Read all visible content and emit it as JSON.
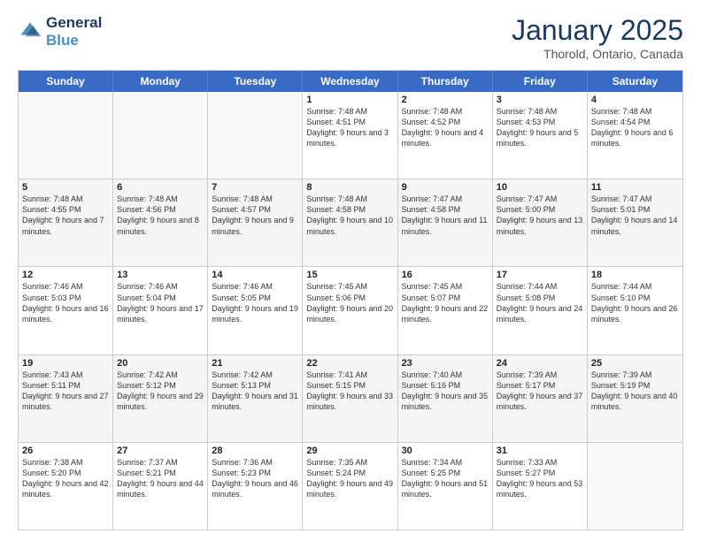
{
  "logo": {
    "line1": "General",
    "line2": "Blue"
  },
  "header": {
    "month": "January 2025",
    "location": "Thorold, Ontario, Canada"
  },
  "days": [
    "Sunday",
    "Monday",
    "Tuesday",
    "Wednesday",
    "Thursday",
    "Friday",
    "Saturday"
  ],
  "rows": [
    [
      {
        "day": "",
        "empty": true
      },
      {
        "day": "",
        "empty": true
      },
      {
        "day": "",
        "empty": true
      },
      {
        "day": "1",
        "rise": "7:48 AM",
        "set": "4:51 PM",
        "daylight": "9 hours and 3 minutes."
      },
      {
        "day": "2",
        "rise": "7:48 AM",
        "set": "4:52 PM",
        "daylight": "9 hours and 4 minutes."
      },
      {
        "day": "3",
        "rise": "7:48 AM",
        "set": "4:53 PM",
        "daylight": "9 hours and 5 minutes."
      },
      {
        "day": "4",
        "rise": "7:48 AM",
        "set": "4:54 PM",
        "daylight": "9 hours and 6 minutes."
      }
    ],
    [
      {
        "day": "5",
        "rise": "7:48 AM",
        "set": "4:55 PM",
        "daylight": "9 hours and 7 minutes."
      },
      {
        "day": "6",
        "rise": "7:48 AM",
        "set": "4:56 PM",
        "daylight": "9 hours and 8 minutes."
      },
      {
        "day": "7",
        "rise": "7:48 AM",
        "set": "4:57 PM",
        "daylight": "9 hours and 9 minutes."
      },
      {
        "day": "8",
        "rise": "7:48 AM",
        "set": "4:58 PM",
        "daylight": "9 hours and 10 minutes."
      },
      {
        "day": "9",
        "rise": "7:47 AM",
        "set": "4:58 PM",
        "daylight": "9 hours and 11 minutes."
      },
      {
        "day": "10",
        "rise": "7:47 AM",
        "set": "5:00 PM",
        "daylight": "9 hours and 13 minutes."
      },
      {
        "day": "11",
        "rise": "7:47 AM",
        "set": "5:01 PM",
        "daylight": "9 hours and 14 minutes."
      }
    ],
    [
      {
        "day": "12",
        "rise": "7:46 AM",
        "set": "5:03 PM",
        "daylight": "9 hours and 16 minutes."
      },
      {
        "day": "13",
        "rise": "7:46 AM",
        "set": "5:04 PM",
        "daylight": "9 hours and 17 minutes."
      },
      {
        "day": "14",
        "rise": "7:46 AM",
        "set": "5:05 PM",
        "daylight": "9 hours and 19 minutes."
      },
      {
        "day": "15",
        "rise": "7:45 AM",
        "set": "5:06 PM",
        "daylight": "9 hours and 20 minutes."
      },
      {
        "day": "16",
        "rise": "7:45 AM",
        "set": "5:07 PM",
        "daylight": "9 hours and 22 minutes."
      },
      {
        "day": "17",
        "rise": "7:44 AM",
        "set": "5:08 PM",
        "daylight": "9 hours and 24 minutes."
      },
      {
        "day": "18",
        "rise": "7:44 AM",
        "set": "5:10 PM",
        "daylight": "9 hours and 26 minutes."
      }
    ],
    [
      {
        "day": "19",
        "rise": "7:43 AM",
        "set": "5:11 PM",
        "daylight": "9 hours and 27 minutes."
      },
      {
        "day": "20",
        "rise": "7:42 AM",
        "set": "5:12 PM",
        "daylight": "9 hours and 29 minutes."
      },
      {
        "day": "21",
        "rise": "7:42 AM",
        "set": "5:13 PM",
        "daylight": "9 hours and 31 minutes."
      },
      {
        "day": "22",
        "rise": "7:41 AM",
        "set": "5:15 PM",
        "daylight": "9 hours and 33 minutes."
      },
      {
        "day": "23",
        "rise": "7:40 AM",
        "set": "5:16 PM",
        "daylight": "9 hours and 35 minutes."
      },
      {
        "day": "24",
        "rise": "7:39 AM",
        "set": "5:17 PM",
        "daylight": "9 hours and 37 minutes."
      },
      {
        "day": "25",
        "rise": "7:39 AM",
        "set": "5:19 PM",
        "daylight": "9 hours and 40 minutes."
      }
    ],
    [
      {
        "day": "26",
        "rise": "7:38 AM",
        "set": "5:20 PM",
        "daylight": "9 hours and 42 minutes."
      },
      {
        "day": "27",
        "rise": "7:37 AM",
        "set": "5:21 PM",
        "daylight": "9 hours and 44 minutes."
      },
      {
        "day": "28",
        "rise": "7:36 AM",
        "set": "5:23 PM",
        "daylight": "9 hours and 46 minutes."
      },
      {
        "day": "29",
        "rise": "7:35 AM",
        "set": "5:24 PM",
        "daylight": "9 hours and 49 minutes."
      },
      {
        "day": "30",
        "rise": "7:34 AM",
        "set": "5:25 PM",
        "daylight": "9 hours and 51 minutes."
      },
      {
        "day": "31",
        "rise": "7:33 AM",
        "set": "5:27 PM",
        "daylight": "9 hours and 53 minutes."
      },
      {
        "day": "",
        "empty": true
      }
    ]
  ],
  "labels": {
    "sunrise": "Sunrise:",
    "sunset": "Sunset:",
    "daylight": "Daylight:"
  },
  "colors": {
    "header_bg": "#3a6bc4",
    "shaded_row": "#f0f0f0"
  }
}
